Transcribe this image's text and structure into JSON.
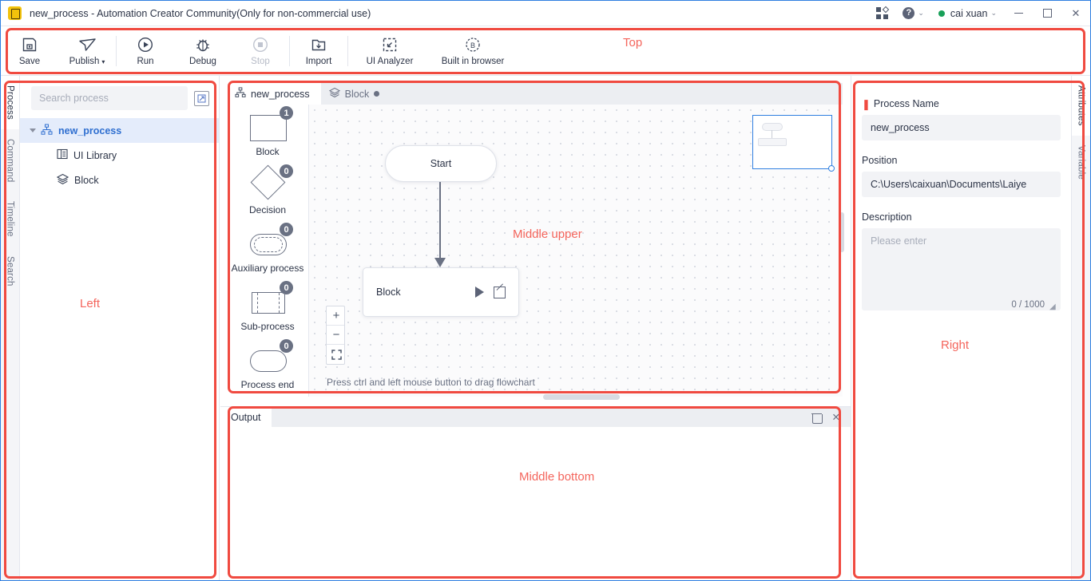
{
  "window": {
    "title": "new_process - Automation Creator Community(Only for non-commercial use)",
    "app_icon": "app-logo-icon",
    "apps_icon": "apps-grid-icon",
    "help_icon": "help-circle-icon",
    "help_caret": "⌄",
    "user_name": "cai xuan",
    "user_caret": "⌄",
    "minimize": "minimize-icon",
    "maximize": "maximize-icon",
    "close": "✕"
  },
  "toolbar": {
    "items": [
      {
        "label": "Save",
        "icon": "save-disk-icon",
        "disabled": false,
        "dropdown": false
      },
      {
        "label": "Publish",
        "icon": "publish-paperplane-icon",
        "disabled": false,
        "dropdown": true
      },
      {
        "label": "Run",
        "icon": "run-play-icon",
        "disabled": false,
        "dropdown": false
      },
      {
        "label": "Debug",
        "icon": "debug-bug-icon",
        "disabled": false,
        "dropdown": false
      },
      {
        "label": "Stop",
        "icon": "stop-square-icon",
        "disabled": true,
        "dropdown": false
      },
      {
        "label": "Import",
        "icon": "import-folder-icon",
        "disabled": false,
        "dropdown": false
      },
      {
        "label": "UI Analyzer",
        "icon": "ui-analyzer-icon",
        "disabled": false,
        "dropdown": false
      },
      {
        "label": "Built in browser",
        "icon": "browser-b-icon",
        "disabled": false,
        "dropdown": false
      }
    ],
    "dropdown_caret": "▾"
  },
  "left_strip": {
    "tabs": [
      {
        "label": "Process",
        "active": true
      },
      {
        "label": "Command",
        "active": false
      },
      {
        "label": "Timeline",
        "active": false
      },
      {
        "label": "Search",
        "active": false
      }
    ]
  },
  "left_panel": {
    "search": {
      "placeholder": "Search process",
      "value": ""
    },
    "collapse_icon": "collapse-panel-icon",
    "tree": [
      {
        "label": "new_process",
        "icon": "process-tree-icon",
        "selected": true,
        "level": 0,
        "expanded": true
      },
      {
        "label": "UI Library",
        "icon": "ui-library-icon",
        "selected": false,
        "level": 1
      },
      {
        "label": "Block",
        "icon": "block-layers-icon",
        "selected": false,
        "level": 1
      }
    ]
  },
  "palette": {
    "items": [
      {
        "label": "Block",
        "count": "1",
        "shape": "rectangle"
      },
      {
        "label": "Decision",
        "count": "0",
        "shape": "diamond"
      },
      {
        "label": "Auxiliary process",
        "count": "0",
        "shape": "stadium-dashed"
      },
      {
        "label": "Sub-process",
        "count": "0",
        "shape": "subroutine"
      },
      {
        "label": "Process end",
        "count": "0",
        "shape": "stadium"
      }
    ]
  },
  "editor": {
    "tabs": [
      {
        "label": "new_process",
        "icon": "process-tree-icon",
        "active": true,
        "dirty": false
      },
      {
        "label": "Block",
        "icon": "block-layers-icon",
        "active": false,
        "dirty": true
      }
    ],
    "nodes": [
      {
        "id": "start",
        "label": "Start",
        "type": "start"
      },
      {
        "id": "block",
        "label": "Block",
        "type": "block",
        "actions": [
          "run-node-icon",
          "edit-node-icon"
        ]
      }
    ],
    "hint": "Press ctrl and left mouse button to drag flowchart",
    "zoom_controls": [
      {
        "name": "zoom-in-button",
        "glyph": "+"
      },
      {
        "name": "zoom-out-button",
        "glyph": "−"
      },
      {
        "name": "fit-screen-button",
        "glyph": "⛶"
      }
    ],
    "minimap": {
      "name": "minimap",
      "viewport_border_color": "#2f7fe0"
    }
  },
  "output": {
    "tab_label": "Output",
    "clear_icon": "trash-icon",
    "close_icon": "✕",
    "content": ""
  },
  "right_strip": {
    "tabs": [
      {
        "label": "Attributes",
        "active": true
      },
      {
        "label": "Variable",
        "active": false
      }
    ]
  },
  "right_panel": {
    "required_mark": "❚",
    "process_name": {
      "label": "Process Name",
      "value": "new_process"
    },
    "position": {
      "label": "Position",
      "value": "C:\\Users\\caixuan\\Documents\\Laiye"
    },
    "description": {
      "label": "Description",
      "placeholder": "Please enter",
      "value": "",
      "counter": "0 / 1000"
    }
  },
  "annotations": {
    "accent_color": "#f04a40",
    "text_color": "#f4655c",
    "labels": [
      {
        "key": "top",
        "text": "Top"
      },
      {
        "key": "left",
        "text": "Left"
      },
      {
        "key": "middle_upper",
        "text": "Middle upper"
      },
      {
        "key": "middle_bottom",
        "text": "Middle bottom"
      },
      {
        "key": "right",
        "text": "Right"
      }
    ]
  }
}
